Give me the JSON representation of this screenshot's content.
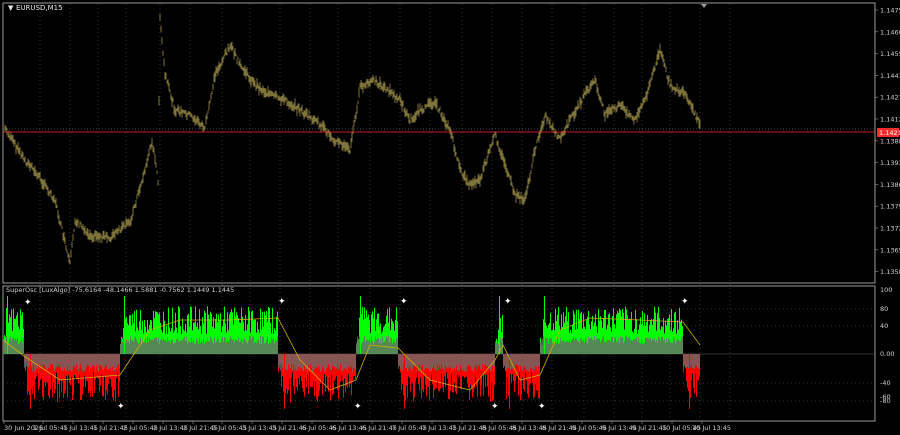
{
  "main_chart": {
    "symbol_label": "EURUSD,M15",
    "current_price": "1.14211",
    "price_ticks": [
      "1.14750",
      "1.14600",
      "1.14555",
      "1.14410",
      "1.14270",
      "1.14125",
      "1.13880",
      "1.13930",
      "1.13860",
      "1.13795",
      "1.13725",
      "1.13655",
      "1.13585"
    ]
  },
  "oscillator": {
    "label": "SuperOsc [LuxAlgo] -75.6164 -48.1466 1.5881 -0.7562 1.1449 1.1445",
    "y_ticks": [
      "100",
      "80",
      "40",
      "0.00",
      "-40",
      "-60",
      "-80"
    ]
  },
  "time_axis": {
    "labels": [
      "30 Jun 2026",
      "1 Jul 05:45",
      "1 Jul 13:45",
      "1 Jul 21:45",
      "2 Jul 05:45",
      "2 Jul 13:45",
      "2 Jul 21:45",
      "3 Jul 05:45",
      "3 Jul 13:45",
      "3 Jul 21:45",
      "6 Jul 05:45",
      "6 Jul 13:45",
      "6 Jul 21:45",
      "7 Jul 05:45",
      "7 Jul 13:45",
      "7 Jul 21:45",
      "8 Jul 05:45",
      "8 Jul 13:45",
      "8 Jul 21:45",
      "9 Jul 05:45",
      "9 Jul 13:45",
      "9 Jul 21:45",
      "10 Jul 05:45",
      "10 Jul 13:45"
    ]
  },
  "colors": {
    "background": "#000000",
    "candles": "#8d8241",
    "price_line": "#ff2b2b",
    "osc_bull": "#00ff00",
    "osc_bear": "#ff0000",
    "osc_fill": "#6a6a6a",
    "signal_line": "#d0b000",
    "grid": "#6b6b6b",
    "marker": "#ffffff"
  }
}
